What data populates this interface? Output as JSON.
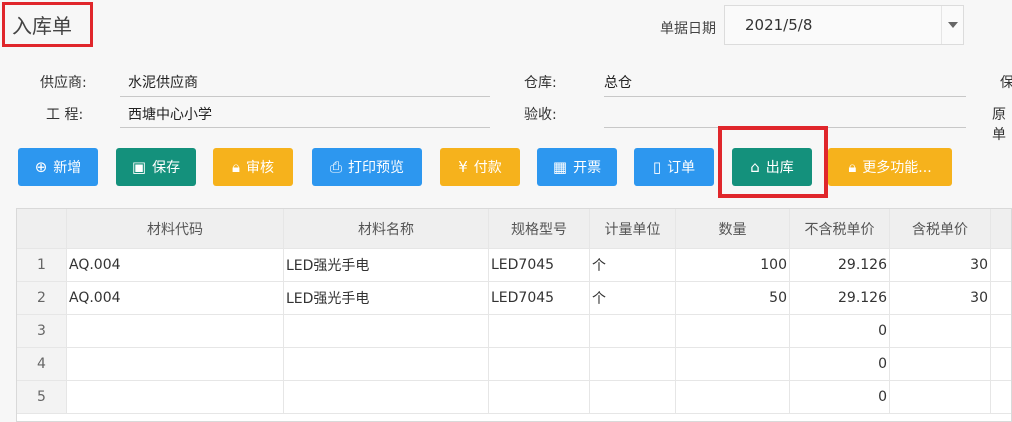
{
  "page": {
    "title": "入库单"
  },
  "date": {
    "label": "单据日期",
    "value": "2021/5/8"
  },
  "form": {
    "supplier_label": "供应商:",
    "supplier_value": "水泥供应商",
    "project_label": "工  程:",
    "project_value": "西塘中心小学",
    "warehouse_label": "仓库:",
    "warehouse_value": "总仓",
    "inspect_label": "验收:",
    "inspect_value": "",
    "extra_label_1": "保",
    "extra_label_2": "原单"
  },
  "toolbar": {
    "add": "新增",
    "save": "保存",
    "audit": "审核",
    "print_preview": "打印预览",
    "payment": "付款",
    "invoice": "开票",
    "order": "订单",
    "outbound": "出库",
    "more": "更多功能..."
  },
  "table": {
    "headers": [
      "材料代码",
      "材料名称",
      "规格型号",
      "计量单位",
      "数量",
      "不含税单价",
      "含税单价"
    ],
    "rows": [
      {
        "no": "1",
        "code": "AQ.004",
        "name": "LED强光手电",
        "spec": "LED7045",
        "unit": "个",
        "qty": "100",
        "price_ex": "29.126",
        "price_in": "30"
      },
      {
        "no": "2",
        "code": "AQ.004",
        "name": "LED强光手电",
        "spec": "LED7045",
        "unit": "个",
        "qty": "50",
        "price_ex": "29.126",
        "price_in": "30"
      },
      {
        "no": "3",
        "code": "",
        "name": "",
        "spec": "",
        "unit": "",
        "qty": "",
        "price_ex": "0",
        "price_in": ""
      },
      {
        "no": "4",
        "code": "",
        "name": "",
        "spec": "",
        "unit": "",
        "qty": "",
        "price_ex": "0",
        "price_in": ""
      },
      {
        "no": "5",
        "code": "",
        "name": "",
        "spec": "",
        "unit": "",
        "qty": "",
        "price_ex": "0",
        "price_in": ""
      }
    ]
  },
  "colors": {
    "blue": "#2d97ef",
    "green": "#14917c",
    "orange": "#f6b21c",
    "highlight_red": "#e0262b"
  }
}
